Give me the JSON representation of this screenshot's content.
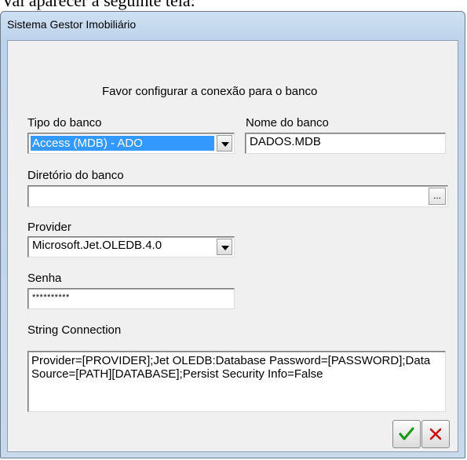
{
  "page_caption": "Vai aparecer a seguinte tela:",
  "window": {
    "title": "Sistema Gestor Imobiliário"
  },
  "intro": "Favor configurar a conexão para o banco",
  "tipo_banco": {
    "label": "Tipo do banco",
    "value": "Access (MDB) - ADO"
  },
  "nome_banco": {
    "label": "Nome do banco",
    "value": "DADOS.MDB"
  },
  "diretorio": {
    "label": "Diretório do banco",
    "value": "",
    "browse_label": "..."
  },
  "provider": {
    "label": "Provider",
    "value": "Microsoft.Jet.OLEDB.4.0"
  },
  "senha": {
    "label": "Senha",
    "value": "**********"
  },
  "connection": {
    "label": "String Connection",
    "value": "Provider=[PROVIDER];Jet OLEDB:Database Password=[PASSWORD];Data Source=[PATH][DATABASE];Persist Security Info=False"
  },
  "buttons": {
    "ok_icon": "check-icon",
    "cancel_icon": "close-icon"
  },
  "colors": {
    "ok": "#1a9a1a",
    "cancel": "#cc1111",
    "selection": "#3399ff"
  }
}
